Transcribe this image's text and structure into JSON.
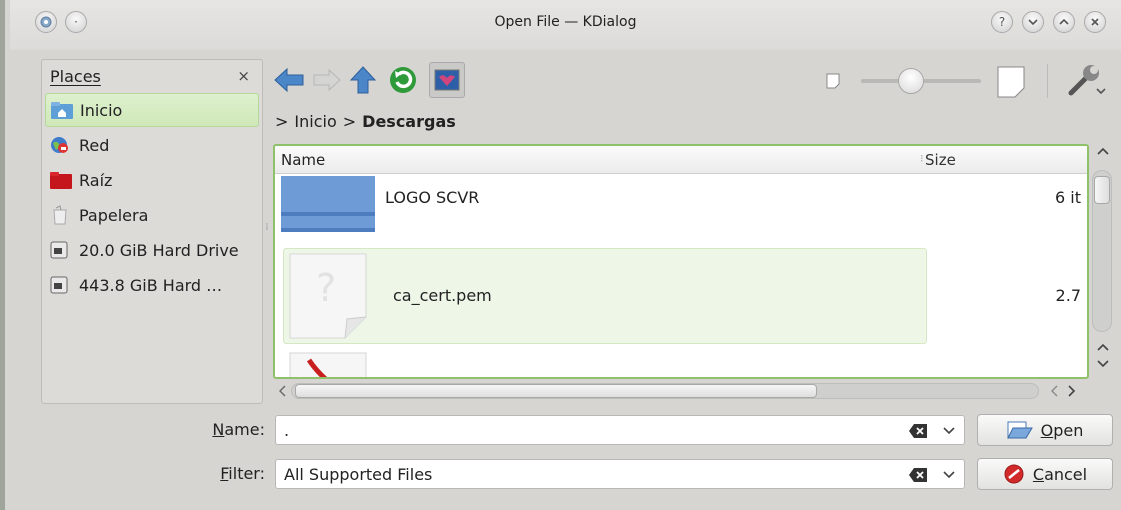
{
  "window": {
    "title": "Open File — KDialog"
  },
  "places": {
    "header": "Places",
    "close_glyph": "×",
    "items": [
      {
        "label": "Inicio",
        "icon": "home-folder-icon",
        "selected": true
      },
      {
        "label": "Red",
        "icon": "network-globe-icon"
      },
      {
        "label": "Raíz",
        "icon": "red-folder-icon"
      },
      {
        "label": "Papelera",
        "icon": "trash-icon"
      },
      {
        "label": "20.0 GiB Hard Drive",
        "icon": "hard-drive-icon"
      },
      {
        "label": "443.8 GiB Hard …",
        "icon": "hard-drive-icon"
      }
    ]
  },
  "breadcrumb": {
    "sep": ">",
    "items": [
      "Inicio",
      "Descargas"
    ]
  },
  "fileview": {
    "columns": {
      "name": "Name",
      "size": "Size"
    },
    "rows": [
      {
        "name": "LOGO SCVR",
        "size": "6 it",
        "icon": "folder-icon"
      },
      {
        "name": "ca_cert.pem",
        "size": "2.7",
        "icon": "unknown-file-icon"
      },
      {
        "name": "",
        "size": "",
        "icon": "pdf-file-icon"
      }
    ]
  },
  "form": {
    "name_label_underline": "N",
    "name_label_rest": "ame:",
    "name_value": ".",
    "filter_label_underline": "F",
    "filter_label_rest": "ilter:",
    "filter_value": "All Supported Files"
  },
  "buttons": {
    "open_underline": "O",
    "open_rest": "pen",
    "cancel_underline": "C",
    "cancel_rest": "ancel"
  },
  "colors": {
    "accent": "#8ec16a",
    "selection": "#cfe8b8"
  }
}
